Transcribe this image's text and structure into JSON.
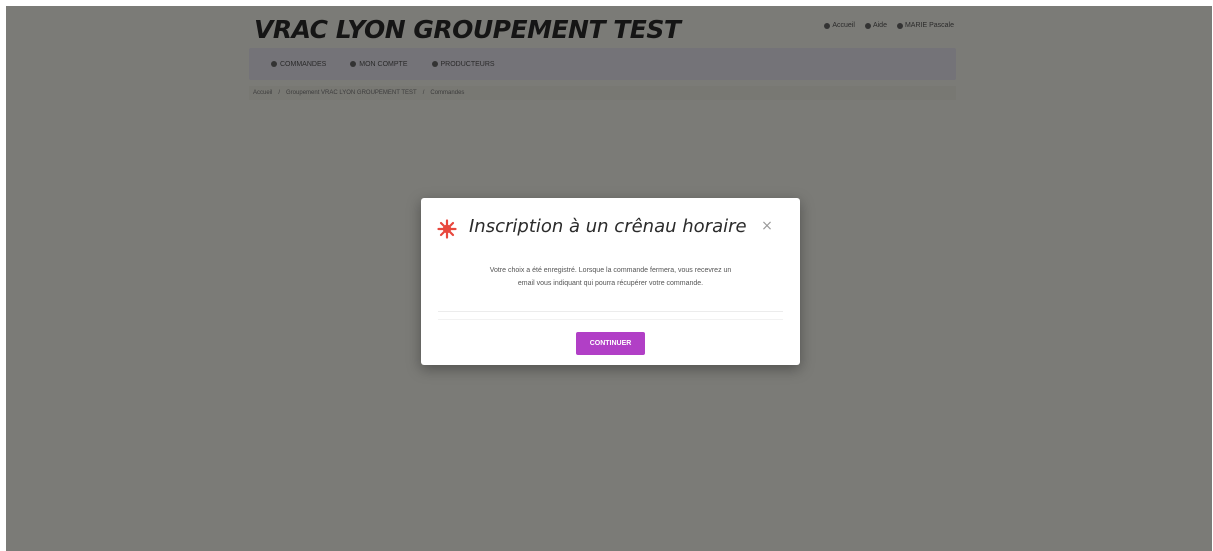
{
  "header": {
    "site_title": "VRAC LYON GROUPEMENT TEST",
    "top_links": [
      "Accueil",
      "Aide",
      "MARIE Pascale"
    ]
  },
  "navbar": {
    "items": [
      "COMMANDES",
      "MON COMPTE",
      "PRODUCTEURS"
    ]
  },
  "breadcrumb": {
    "items": [
      "Accueil",
      "Groupement VRAC LYON GROUPEMENT TEST",
      "Commandes"
    ]
  },
  "modal": {
    "title": "Inscription à un crênau horaire",
    "close_label": "×",
    "body_line1": "Votre choix a été enregistré. Lorsque la commande fermera, vous recevrez un",
    "body_line2": "email vous indiquant qui pourra récupérer votre commande.",
    "continue_label": "CONTINUER"
  },
  "colors": {
    "accent": "#b13fc6",
    "icon": "#e8473d",
    "overlay": "#7d7a73"
  },
  "icons": {
    "modal_icon": "starburst-icon",
    "close_icon": "close-icon"
  }
}
